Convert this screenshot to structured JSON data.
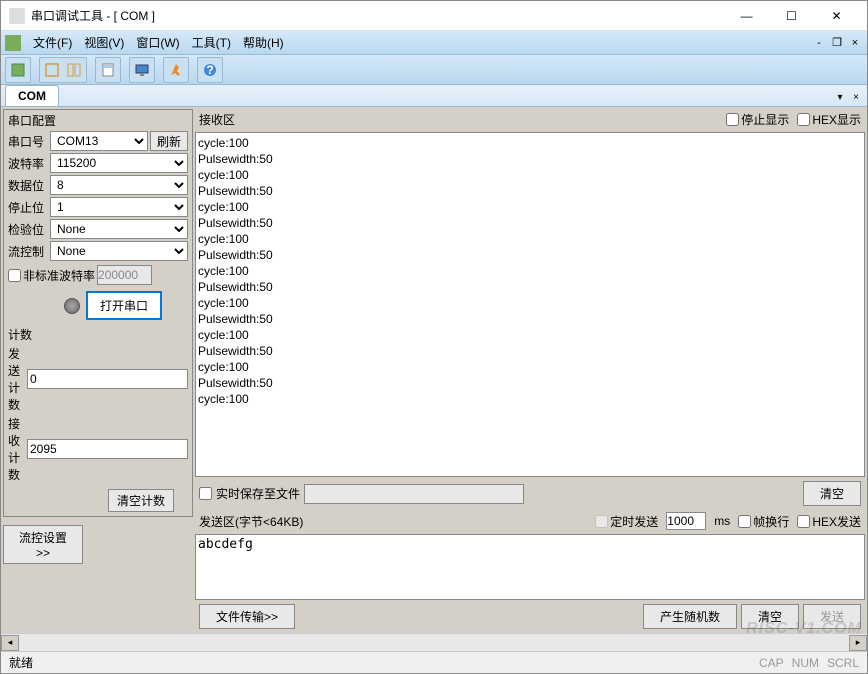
{
  "window": {
    "title": "串口调试工具 - [ COM ]"
  },
  "menu": {
    "file": "文件(F)",
    "view": "视图(V)",
    "window": "窗口(W)",
    "tools": "工具(T)",
    "help": "帮助(H)"
  },
  "tabs": {
    "com": "COM"
  },
  "serial_config": {
    "legend": "串口配置",
    "port_label": "串口号",
    "port_value": "COM13",
    "refresh": "刷新",
    "baud_label": "波特率",
    "baud_value": "115200",
    "databits_label": "数据位",
    "databits_value": "8",
    "stopbits_label": "停止位",
    "stopbits_value": "1",
    "parity_label": "检验位",
    "parity_value": "None",
    "flowctrl_label": "流控制",
    "flowctrl_value": "None",
    "nonstd_label": "非标准波特率",
    "nonstd_value": "200000",
    "open_btn": "打开串口"
  },
  "counters": {
    "legend": "计数",
    "send_label": "发送计数",
    "send_value": "0",
    "recv_label": "接收计数",
    "recv_value": "2095",
    "clear": "清空计数"
  },
  "flow_settings_btn": "流控设置>>",
  "rx": {
    "title": "接收区",
    "stop_display": "停止显示",
    "hex_display": "HEX显示",
    "lines": [
      "cycle:100",
      "Pulsewidth:50",
      "cycle:100",
      "Pulsewidth:50",
      "cycle:100",
      "Pulsewidth:50",
      "cycle:100",
      "Pulsewidth:50",
      "cycle:100",
      "Pulsewidth:50",
      "cycle:100",
      "Pulsewidth:50",
      "cycle:100",
      "Pulsewidth:50",
      "cycle:100",
      "Pulsewidth:50",
      "cycle:100"
    ]
  },
  "save_file": {
    "label": "实时保存至文件",
    "clear": "清空"
  },
  "tx": {
    "title": "发送区(字节<64KB)",
    "timed_send": "定时发送",
    "interval": "1000",
    "ms": "ms",
    "frame_wrap": "帧换行",
    "hex_send": "HEX发送",
    "content": "abcdefg"
  },
  "bottom_buttons": {
    "file_transfer": "文件传输>>",
    "random": "产生随机数",
    "clear": "清空",
    "send": "发送"
  },
  "statusbar": {
    "ready": "就绪",
    "cap": "CAP",
    "num": "NUM",
    "scrl": "SCRL"
  },
  "watermark": "RISC-V1.COM"
}
